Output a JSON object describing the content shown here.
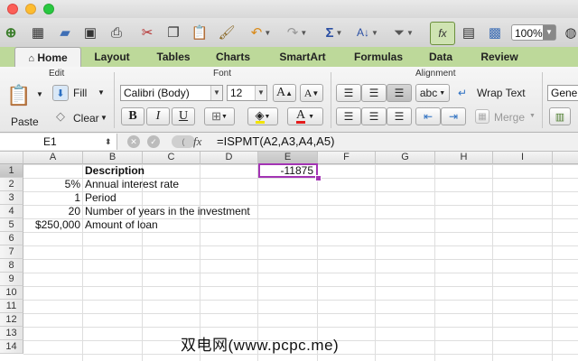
{
  "toolbar": {
    "icons": [
      "new-document-icon",
      "templates-icon",
      "open-icon",
      "save-icon",
      "print-icon",
      "cut-icon",
      "copy-icon",
      "paste-icon",
      "format-painter-icon",
      "undo-icon",
      "redo-icon",
      "autosum-icon",
      "sort-icon",
      "filter-icon",
      "function-icon",
      "show-formula-builder-icon",
      "media-browser-icon"
    ],
    "zoom": "100%"
  },
  "tabs": [
    "Home",
    "Layout",
    "Tables",
    "Charts",
    "SmartArt",
    "Formulas",
    "Data",
    "Review"
  ],
  "active_tab": "Home",
  "ribbon": {
    "edit": {
      "group_label": "Edit",
      "paste_label": "Paste",
      "fill_label": "Fill",
      "clear_label": "Clear"
    },
    "font": {
      "group_label": "Font",
      "font_name": "Calibri (Body)",
      "font_size": "12",
      "bold": "B",
      "italic": "I",
      "underline": "U",
      "grow_font": "A",
      "shrink_font": "A",
      "font_color": "A"
    },
    "alignment": {
      "group_label": "Alignment",
      "abc_label": "abc",
      "wrap_text_label": "Wrap Text",
      "merge_label": "Merge"
    },
    "number": {
      "format_value": "General"
    }
  },
  "formula_bar": {
    "name_box": "E1",
    "fx_label": "fx",
    "formula": "=ISPMT(A2,A3,A4,A5)"
  },
  "sheet": {
    "columns": [
      "A",
      "B",
      "C",
      "D",
      "E",
      "F",
      "G",
      "H",
      "I"
    ],
    "rows": [
      "1",
      "2",
      "3",
      "4",
      "5",
      "6",
      "7",
      "8",
      "9",
      "10",
      "11",
      "12",
      "13",
      "14"
    ],
    "selected_cell": "E1",
    "cells": {
      "B1": "Description",
      "E1": "-11875",
      "A2": "5%",
      "B2": "Annual interest rate",
      "A3": "1",
      "B3": "Period",
      "A4": "20",
      "B4": "Number of years in the investment",
      "A5": "$250,000",
      "B5": "Amount of loan"
    }
  },
  "watermark": "双电网(www.pcpc.me)",
  "colors": {
    "ribbon_tab_bar": "#bdd99a",
    "selection": "#a334b4"
  }
}
